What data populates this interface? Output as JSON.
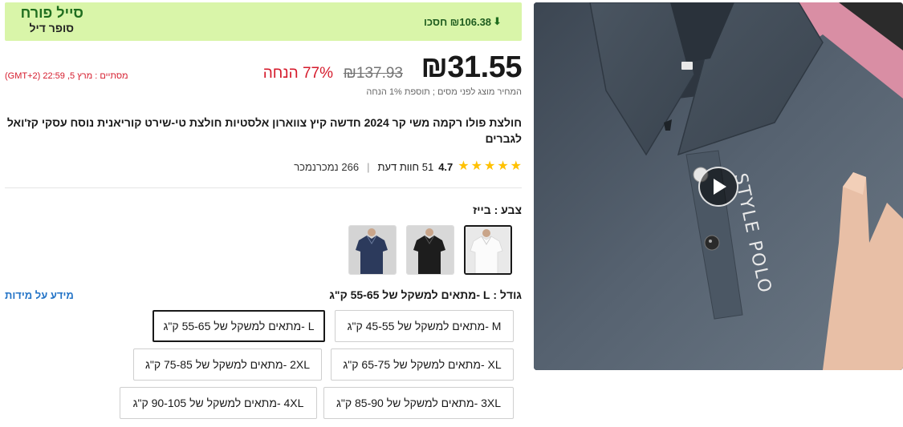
{
  "deal": {
    "title": "סייל פורח",
    "subtitle": "סופר דיל",
    "save_text": "₪106.38 חסכו"
  },
  "pricing": {
    "price": "₪31.55",
    "original_price": "₪137.93",
    "discount": "77% הנחה",
    "tax_note": "המחיר מוצג לפני מסים ; תוספת 1% הנחה",
    "end_time": "מסתיים : מרץ 5, 22:59 (GMT+2)"
  },
  "product": {
    "title": "חולצת פולו רקמה משי קר 2024 חדשה קיץ צווארון אלסטיות חולצת טי-שירט קוריאנית נוסח עסקי קז'ואל לגברים"
  },
  "rating": {
    "score": "4.7",
    "reviews": "51 חוות דעת",
    "sold": "266 נמכרנמכר",
    "stars": 5,
    "star_color": "#ffc100"
  },
  "color": {
    "label": "צבע : בייז",
    "options": [
      {
        "name": "white",
        "color": "#f2f2f2",
        "selected": true
      },
      {
        "name": "black",
        "color": "#1d1d1d",
        "selected": false
      },
      {
        "name": "navy",
        "color": "#2c3a5c",
        "selected": false
      }
    ]
  },
  "size": {
    "label": "גודל : L -מתאים למשקל של 55-65 ק\"ג",
    "guide_link": "מידע על מידות",
    "options": [
      {
        "label": "M -מתאים למשקל של 45-55 ק\"ג",
        "selected": false
      },
      {
        "label": "L -מתאים למשקל של 55-65 ק\"ג",
        "selected": true
      },
      {
        "label": "XL -מתאים למשקל של 65-75 ק\"ג",
        "selected": false
      },
      {
        "label": "2XL -מתאים למשקל של 75-85 ק\"ג",
        "selected": false
      },
      {
        "label": "3XL -מתאים למשקל של 85-90 ק\"ג",
        "selected": false
      },
      {
        "label": "4XL -מתאים למשקל של 90-105 ק\"ג",
        "selected": false
      }
    ]
  },
  "hero": {
    "shirt_print": "STYLE POLO",
    "play_icon": "play-icon"
  },
  "colors": {
    "deal_bg": "#d9f5a9",
    "sale_red": "#d51a2b",
    "link_blue": "#2474c7"
  }
}
